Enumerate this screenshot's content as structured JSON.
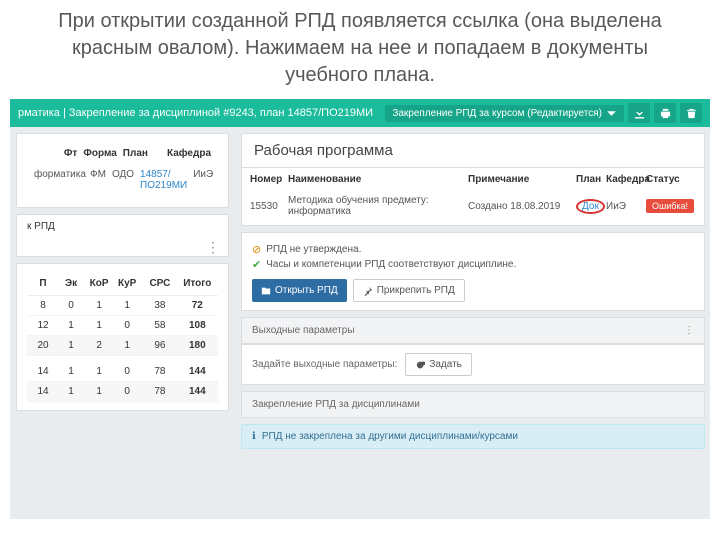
{
  "slide": {
    "title": "При открытии созданной РПД появляется ссылка (она выделена красным овалом). Нажимаем на нее и попадаем в документы учебного плана."
  },
  "greenbar": {
    "title_left": "рматика | Закрепление за дисциплиной #9243, план 14857/ПО219МИ",
    "dropdown": "Закрепление РПД за курсом (Редактируется)"
  },
  "filter": {
    "headers": {
      "ft": "Фт",
      "forma": "Форма",
      "plan": "План",
      "kaf": "Кафедра"
    },
    "row": {
      "name": "форматика",
      "ft": "ФМ",
      "forma": "ОДО",
      "plan": "14857/ПО219МИ",
      "kaf": "ИиЭ"
    },
    "k_label": "к РПД"
  },
  "grid": {
    "headers": [
      "П",
      "Эк",
      "КоР",
      "КуР",
      "СРС",
      "Итого"
    ],
    "rows": [
      [
        "8",
        "0",
        "1",
        "1",
        "38",
        "72"
      ],
      [
        "12",
        "1",
        "1",
        "0",
        "58",
        "108"
      ],
      [
        "20",
        "1",
        "2",
        "1",
        "96",
        "180"
      ],
      [
        "14",
        "1",
        "1",
        "0",
        "78",
        "144"
      ],
      [
        "14",
        "1",
        "1",
        "0",
        "78",
        "144"
      ]
    ]
  },
  "panel": {
    "title": "Рабочая программа",
    "headers": {
      "num": "Номер",
      "name": "Наименование",
      "note": "Примечание",
      "plan": "План",
      "kaf": "Кафедра",
      "stat": "Статус"
    },
    "row": {
      "num": "15530",
      "name": "Методика обучения предмету: информатика",
      "note": "Создано 18.08.2019",
      "plan": "Док",
      "kaf": "ИиЭ",
      "stat": "Ошибка!"
    },
    "msg_unapproved": "РПД не утверждена.",
    "msg_hours": "Часы и компетенции РПД соответствуют дисциплине.",
    "btn_open": "Открыть РПД",
    "btn_attach": "Прикрепить РПД"
  },
  "params": {
    "title": "Выходные параметры",
    "body_text": "Задайте выходные параметры:",
    "btn": "Задать"
  },
  "assign": {
    "title": "Закрепление РПД за дисциплинами",
    "alert": "РПД не закреплена за другими дисциплинами/курсами"
  }
}
